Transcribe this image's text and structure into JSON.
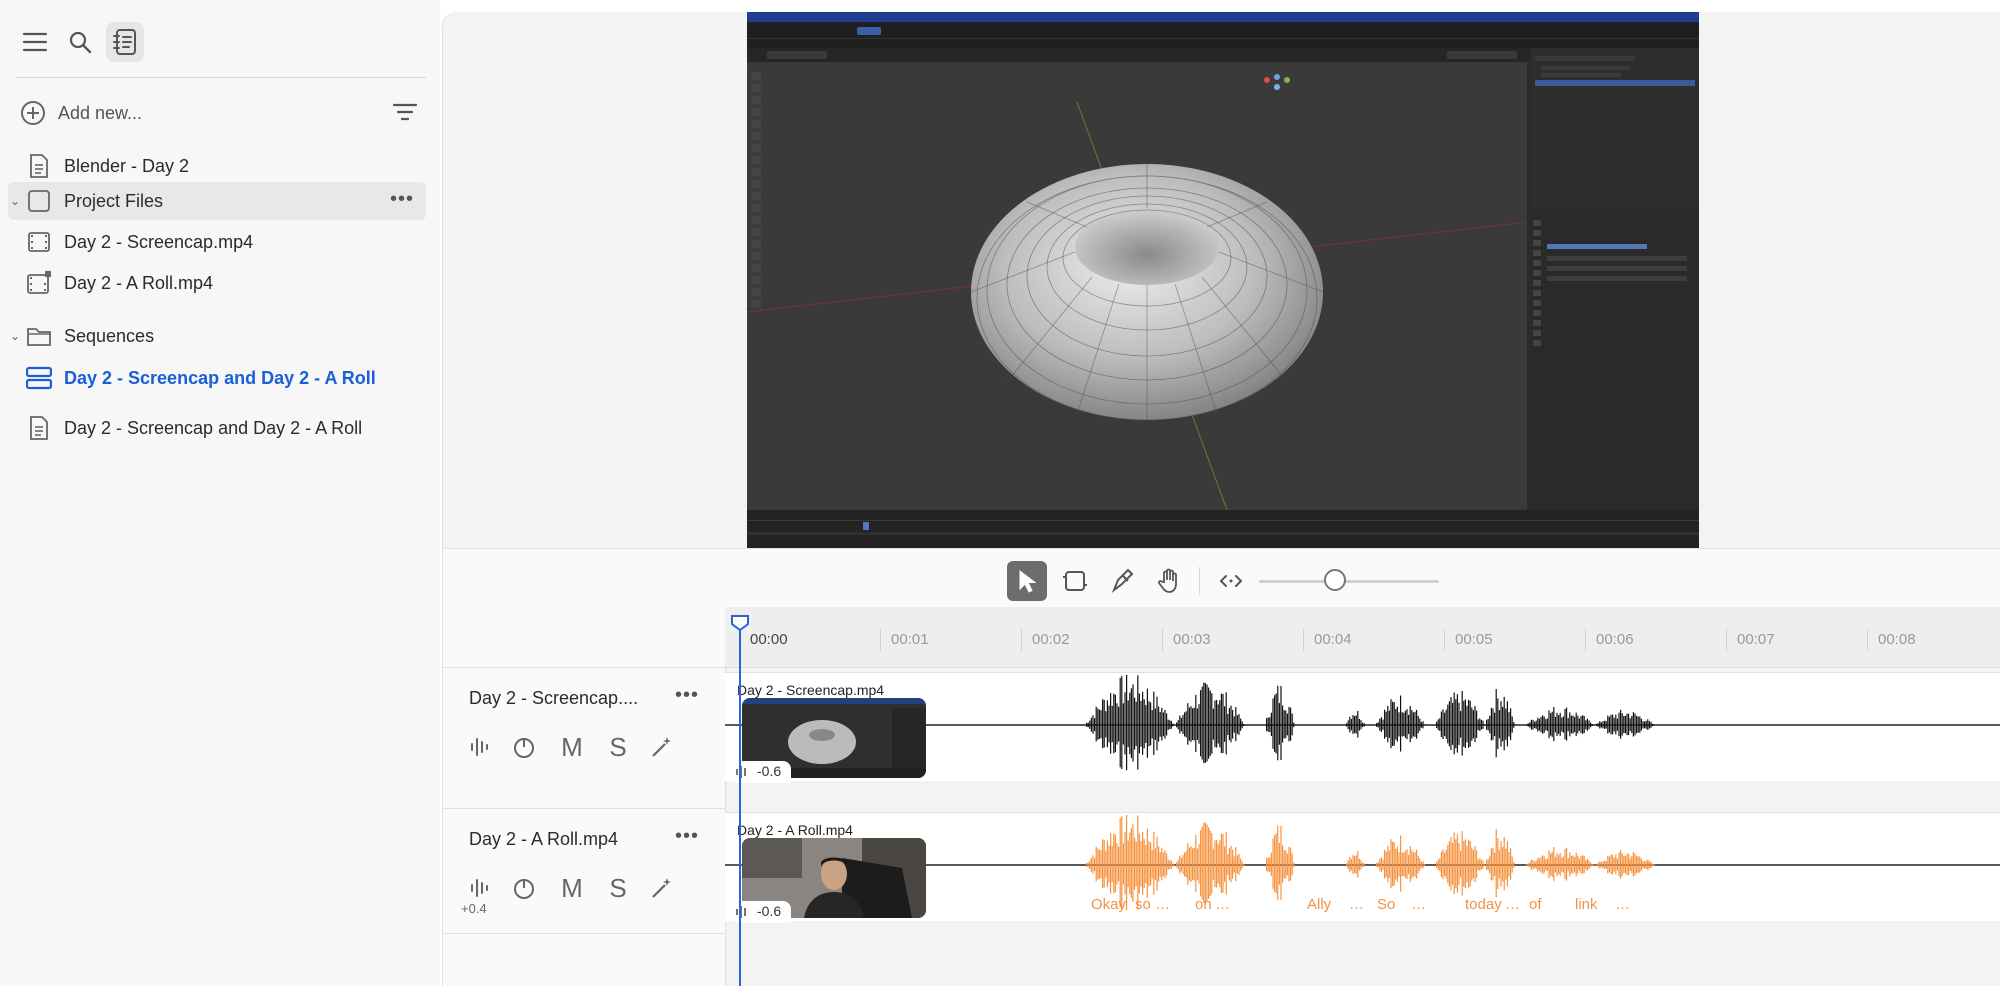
{
  "sidebar": {
    "add_new": "Add new...",
    "items": [
      {
        "label": "Blender - Day 2"
      },
      {
        "label": "Project Files"
      },
      {
        "label": "Day 2 - Screencap.mp4"
      },
      {
        "label": "Day 2 - A Roll.mp4"
      },
      {
        "label": "Sequences"
      },
      {
        "label": "Day 2 - Screencap and Day 2 - A Roll"
      },
      {
        "label": "Day 2 - Screencap and Day 2 - A Roll"
      }
    ]
  },
  "timeline": {
    "ruler": [
      "00:00",
      "00:01",
      "00:02",
      "00:03",
      "00:04",
      "00:05",
      "00:06",
      "00:07",
      "00:08"
    ],
    "zoom_level": 0.42,
    "tracks": [
      {
        "name": "Day 2 - Screencap....",
        "clip_title": "Day 2 - Screencap.mp4",
        "clip_gain": "-0.6",
        "track_gain": "",
        "controls": {
          "mute": "M",
          "solo": "S"
        }
      },
      {
        "name": "Day 2 - A Roll.mp4",
        "clip_title": "Day 2 - A Roll.mp4",
        "clip_gain": "-0.6",
        "track_gain": "+0.4",
        "controls": {
          "mute": "M",
          "solo": "S"
        },
        "words": [
          "Okay",
          "so",
          "…",
          "on",
          "…",
          "Ally",
          "…",
          "So",
          "…",
          "today",
          "…",
          "of",
          "link",
          "…"
        ]
      }
    ]
  },
  "colors": {
    "accent_blue": "#1a5fd6",
    "playhead": "#2d62d9",
    "waveform_active": "#f7923f",
    "waveform": "#111111"
  }
}
